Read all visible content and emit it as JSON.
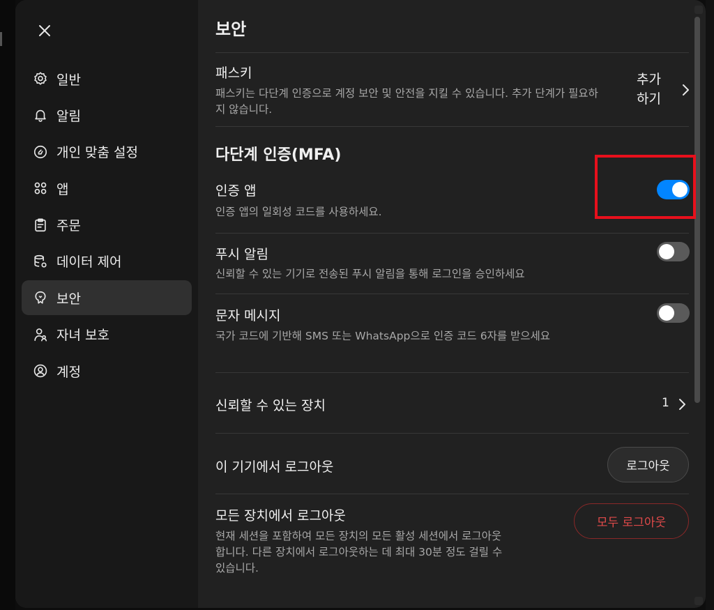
{
  "sidebar": {
    "items": [
      {
        "label": "일반",
        "icon": "gear-icon"
      },
      {
        "label": "알림",
        "icon": "bell-icon"
      },
      {
        "label": "개인 맞춤 설정",
        "icon": "personalization-icon"
      },
      {
        "label": "앱",
        "icon": "apps-grid-icon"
      },
      {
        "label": "주문",
        "icon": "clipboard-icon"
      },
      {
        "label": "데이터 제어",
        "icon": "database-gear-icon"
      },
      {
        "label": "보안",
        "icon": "shield-icon",
        "active": true
      },
      {
        "label": "자녀 보호",
        "icon": "family-icon"
      },
      {
        "label": "계정",
        "icon": "account-circle-icon"
      }
    ]
  },
  "page": {
    "title": "보안",
    "passkey": {
      "title": "패스키",
      "desc": "패스키는 다단계 인증으로 계정 보안 및 안전을 지킬 수 있습니다. 추가 단계가 필요하지 않습니다.",
      "action": "추가 하기"
    },
    "mfa": {
      "title": "다단계 인증(MFA)",
      "authenticator": {
        "title": "인증 앱",
        "desc": "인증 앱의 일회성 코드를 사용하세요.",
        "enabled": true
      },
      "push": {
        "title": "푸시 알림",
        "desc": "신뢰할 수 있는 기기로 전송된 푸시 알림을 통해 로그인을 승인하세요",
        "enabled": false
      },
      "sms": {
        "title": "문자 메시지",
        "desc": "국가 코드에 기반해 SMS 또는 WhatsApp으로 인증 코드 6자를 받으세요",
        "enabled": false
      }
    },
    "trusted_devices": {
      "title": "신뢰할 수 있는 장치",
      "count": "1"
    },
    "logout_this": {
      "title": "이 기기에서 로그아웃",
      "button": "로그아웃"
    },
    "logout_all": {
      "title": "모든 장치에서 로그아웃",
      "desc": "현재 세션을 포함하여 모든 장치의 모든 활성 세션에서 로그아웃합니다. 다른 장치에서 로그아웃하는 데 최대 30분 정도 걸릴 수 있습니다.",
      "button": "모두 로그아웃"
    }
  },
  "colors": {
    "toggle_on": "#0285ff",
    "toggle_off": "#5a5a5a",
    "danger": "#e04a4a",
    "highlight": "#e8101c"
  }
}
